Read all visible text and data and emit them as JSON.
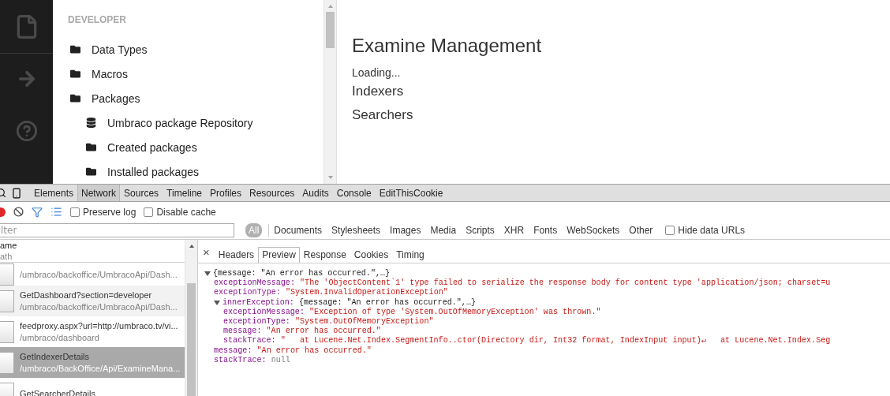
{
  "app": {
    "section_title": "DEVELOPER",
    "tree": [
      {
        "label": "Data Types",
        "kind": "folder"
      },
      {
        "label": "Macros",
        "kind": "folder"
      },
      {
        "label": "Packages",
        "kind": "folder",
        "children": [
          {
            "label": "Umbraco package Repository",
            "kind": "repository"
          },
          {
            "label": "Created packages",
            "kind": "folder"
          },
          {
            "label": "Installed packages",
            "kind": "folder"
          }
        ]
      }
    ],
    "content": {
      "title": "Examine Management",
      "status": "Loading...",
      "sections": [
        "Indexers",
        "Searchers"
      ]
    }
  },
  "devtools": {
    "tabs": [
      {
        "label": "Elements",
        "selected": false
      },
      {
        "label": "Network",
        "selected": true
      },
      {
        "label": "Sources",
        "selected": false
      },
      {
        "label": "Timeline",
        "selected": false
      },
      {
        "label": "Profiles",
        "selected": false
      },
      {
        "label": "Resources",
        "selected": false
      },
      {
        "label": "Audits",
        "selected": false
      },
      {
        "label": "Console",
        "selected": false
      },
      {
        "label": "EditThisCookie",
        "selected": false
      }
    ],
    "options": [
      {
        "label": "Preserve log",
        "checked": false
      },
      {
        "label": "Disable cache",
        "checked": false
      }
    ],
    "filter": {
      "placeholder": "lter"
    },
    "types": [
      {
        "label": "All",
        "selected": true
      },
      {
        "label": "Documents",
        "selected": false
      },
      {
        "label": "Stylesheets",
        "selected": false
      },
      {
        "label": "Images",
        "selected": false
      },
      {
        "label": "Media",
        "selected": false
      },
      {
        "label": "Scripts",
        "selected": false
      },
      {
        "label": "XHR",
        "selected": false
      },
      {
        "label": "Fonts",
        "selected": false
      },
      {
        "label": "WebSockets",
        "selected": false
      },
      {
        "label": "Other",
        "selected": false
      }
    ],
    "hide_data_urls": {
      "label": "Hide data URLs",
      "checked": false
    },
    "columns": [
      "ame",
      "ath"
    ],
    "requests": [
      {
        "path": "/umbraco/backoffice/UmbracoApi/Dash...",
        "selected": false
      },
      {
        "name": "GetDashboard?section=developer",
        "path": "/umbraco/backoffice/UmbracoApi/Dash...",
        "selected": false
      },
      {
        "name": "feedproxy.aspx?url=http://umbraco.tv/vi...",
        "path": "/umbraco/dashboard",
        "selected": false
      },
      {
        "name": "GetIndexerDetails",
        "path": "/umbraco/BackOffice/Api/ExamineMana...",
        "selected": true
      },
      {
        "name": "GetSearcherDetails",
        "selected": false
      }
    ],
    "close": "×",
    "detail_tabs": [
      {
        "label": "Headers",
        "selected": false
      },
      {
        "label": "Preview",
        "selected": true
      },
      {
        "label": "Response",
        "selected": false
      },
      {
        "label": "Cookies",
        "selected": false
      },
      {
        "label": "Timing",
        "selected": false
      }
    ],
    "preview": {
      "summary": "{message: \"An error has occurred.\",…}",
      "expanded": true,
      "children": [
        {
          "key": "exceptionMessage:",
          "kind": "string",
          "value": "\"The 'ObjectContent`1' type failed to serialize the response body for content type 'application/json; charset=u"
        },
        {
          "key": "exceptionType:",
          "kind": "string",
          "value": "\"System.InvalidOperationException\""
        },
        {
          "key": "innerException:",
          "kind": "object",
          "value": "{message: \"An error has occurred.\",…}",
          "expanded": true,
          "children": [
            {
              "key": "exceptionMessage:",
              "kind": "string",
              "value": "\"Exception of type 'System.OutOfMemoryException' was thrown.\""
            },
            {
              "key": "exceptionType:",
              "kind": "string",
              "value": "\"System.OutOfMemoryException\""
            },
            {
              "key": "message:",
              "kind": "string",
              "value": "\"An error has occurred.\""
            },
            {
              "key": "stackTrace:",
              "kind": "string",
              "value": "\"   at Lucene.Net.Index.SegmentInfo..ctor(Directory dir, Int32 format, IndexInput input)↵   at Lucene.Net.Index.Seg"
            }
          ]
        },
        {
          "key": "message:",
          "kind": "string",
          "value": "\"An error has occurred.\""
        },
        {
          "key": "stackTrace:",
          "kind": "null",
          "value": "null"
        }
      ]
    }
  }
}
